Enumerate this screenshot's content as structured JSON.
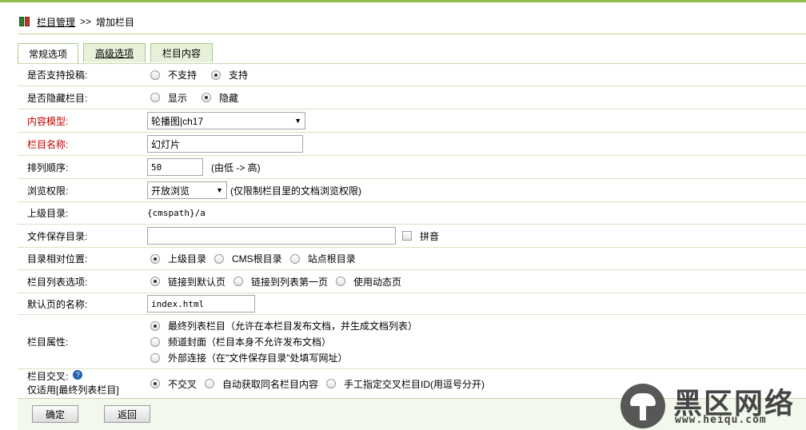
{
  "breadcrumb": {
    "root": "栏目管理",
    "separator": ">>",
    "current": "增加栏目"
  },
  "tabs": [
    {
      "label": "常规选项"
    },
    {
      "label": "高级选项"
    },
    {
      "label": "栏目内容"
    }
  ],
  "rows": {
    "allow_submit": {
      "label": "是否支持投稿:",
      "options": [
        "不支持",
        "支持"
      ],
      "selected": "支持"
    },
    "hide": {
      "label": "是否隐藏栏目:",
      "options": [
        "显示",
        "隐藏"
      ],
      "selected": "隐藏"
    },
    "content_model": {
      "label": "内容模型:",
      "value": "轮播图|ch17"
    },
    "name": {
      "label": "栏目名称:",
      "value": "幻灯片"
    },
    "order": {
      "label": "排列顺序:",
      "value": "50",
      "hint": "(由低 -> 高)"
    },
    "permission": {
      "label": "浏览权限:",
      "value": "开放浏览",
      "hint": "(仅限制栏目里的文档浏览权限)"
    },
    "parent": {
      "label": "上级目录:",
      "value": "{cmspath}/a"
    },
    "save_dir": {
      "label": "文件保存目录:",
      "value": "",
      "pinyin_label": "拼音"
    },
    "relative": {
      "label": "目录相对位置:",
      "options": [
        "上级目录",
        "CMS根目录",
        "站点根目录"
      ],
      "selected": "上级目录"
    },
    "list_option": {
      "label": "栏目列表选项:",
      "options": [
        "链接到默认页",
        "链接到列表第一页",
        "使用动态页"
      ],
      "selected": "链接到默认页"
    },
    "default_page": {
      "label": "默认页的名称:",
      "value": "index.html"
    },
    "attribute": {
      "label": "栏目属性:",
      "options": [
        "最终列表栏目（允许在本栏目发布文档，并生成文档列表）",
        "频道封面（栏目本身不允许发布文档）",
        "外部连接（在\"文件保存目录\"处填写网址）"
      ],
      "selected": "最终列表栏目（允许在本栏目发布文档，并生成文档列表）"
    },
    "cross": {
      "label": "栏目交叉:",
      "sublabel": "仅适用[最终列表栏目]",
      "options": [
        "不交叉",
        "自动获取同名栏目内容",
        "手工指定交叉栏目ID(用逗号分开)"
      ],
      "selected": "不交叉"
    }
  },
  "buttons": {
    "ok": "确定",
    "back": "返回"
  },
  "watermark": {
    "title": "黑区网络",
    "url": "www.heiqu.com"
  }
}
